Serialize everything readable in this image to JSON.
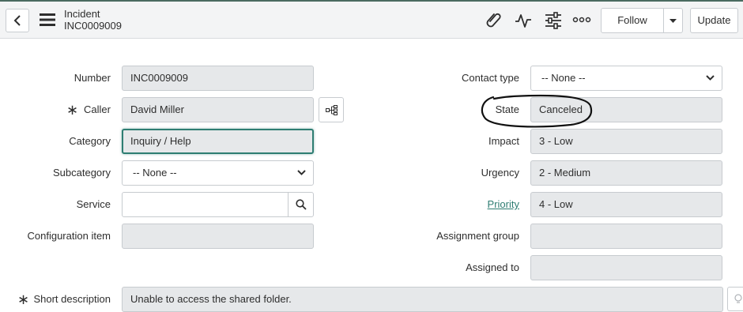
{
  "header": {
    "title": "Incident",
    "subtitle": "INC0009009",
    "follow_label": "Follow",
    "update_label": "Update"
  },
  "form": {
    "left": {
      "number": {
        "label": "Number",
        "value": "INC0009009"
      },
      "caller": {
        "label": "Caller",
        "value": "David Miller"
      },
      "category": {
        "label": "Category",
        "value": "Inquiry / Help"
      },
      "subcategory": {
        "label": "Subcategory",
        "value": "-- None --"
      },
      "service": {
        "label": "Service",
        "value": ""
      },
      "config_item": {
        "label": "Configuration item",
        "value": ""
      }
    },
    "right": {
      "contact_type": {
        "label": "Contact type",
        "value": "-- None --"
      },
      "state": {
        "label": "State",
        "value": "Canceled"
      },
      "impact": {
        "label": "Impact",
        "value": "3 - Low"
      },
      "urgency": {
        "label": "Urgency",
        "value": "2 - Medium"
      },
      "priority": {
        "label": "Priority",
        "value": "4 - Low"
      },
      "assignment_group": {
        "label": "Assignment group",
        "value": ""
      },
      "assigned_to": {
        "label": "Assigned to",
        "value": ""
      }
    },
    "short_description": {
      "label": "Short description",
      "value": "Unable to access the shared folder."
    }
  },
  "colors": {
    "accent": "#2e7d72",
    "field_readonly": "#e6e8ea",
    "header_bg": "#f3f4f5"
  }
}
